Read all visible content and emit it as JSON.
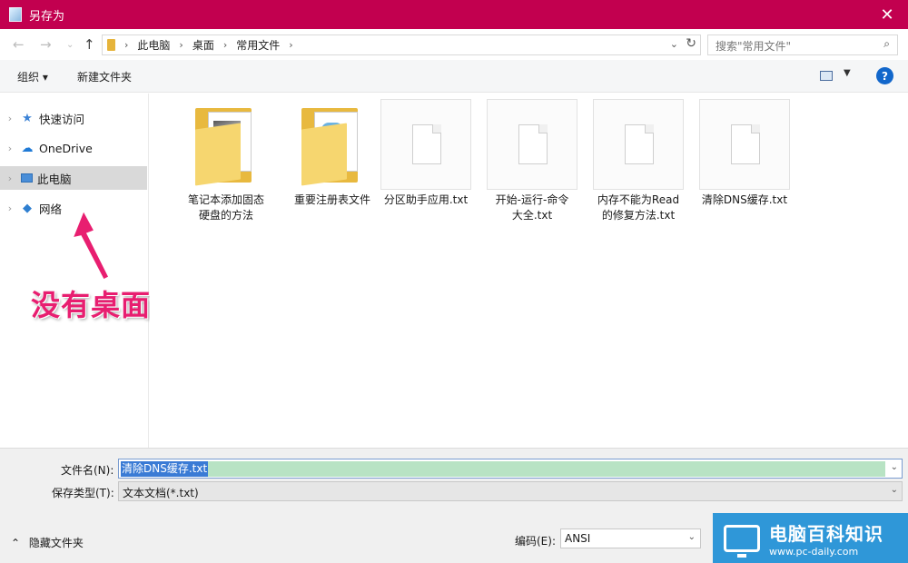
{
  "window": {
    "title": "另存为",
    "close_glyph": "✕"
  },
  "address_bar": {
    "breadcrumbs": [
      "此电脑",
      "桌面",
      "常用文件"
    ],
    "search_placeholder": "搜索\"常用文件\""
  },
  "toolbar": {
    "organize_label": "组织 ▾",
    "new_folder_label": "新建文件夹",
    "help_glyph": "?"
  },
  "sidebar": {
    "items": [
      {
        "label": "快速访问",
        "icon": "star-icon"
      },
      {
        "label": "OneDrive",
        "icon": "cloud-icon"
      },
      {
        "label": "此电脑",
        "icon": "computer-icon"
      },
      {
        "label": "网络",
        "icon": "network-icon"
      }
    ]
  },
  "annotation": {
    "text": "没有桌面项"
  },
  "files": [
    {
      "name_line1": "笔记本添加固态",
      "name_line2": "硬盘的方法",
      "type": "folder"
    },
    {
      "name_line1": "重要注册表文件",
      "name_line2": "",
      "type": "folder"
    },
    {
      "name_line1": "分区助手应用.txt",
      "name_line2": "",
      "type": "txt"
    },
    {
      "name_line1": "开始-运行-命令",
      "name_line2": "大全.txt",
      "type": "txt"
    },
    {
      "name_line1": "内存不能为Read",
      "name_line2": "的修复方法.txt",
      "type": "txt"
    },
    {
      "name_line1": "清除DNS缓存.txt",
      "name_line2": "",
      "type": "txt"
    }
  ],
  "save_form": {
    "filename_label": "文件名(N):",
    "filename_value": "清除DNS缓存.txt",
    "type_label": "保存类型(T):",
    "type_value": "文本文档(*.txt)",
    "hide_folders_label": "隐藏文件夹",
    "encoding_label": "编码(E):",
    "encoding_value": "ANSI"
  },
  "watermark": {
    "title": "电脑百科知识",
    "url": "www.pc-daily.com"
  },
  "colors": {
    "titlebar": "#c2004f",
    "annotation": "#e81e70",
    "watermark_bg": "#2f97d8"
  }
}
